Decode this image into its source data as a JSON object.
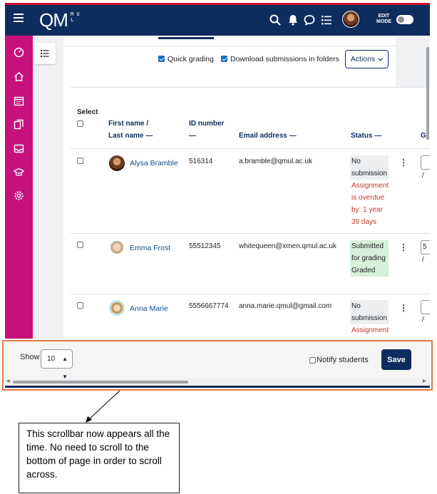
{
  "header": {
    "logo": "QM",
    "logo_sub_1": "M U",
    "logo_sub_2": "L",
    "edit_mode_line1": "EDIT",
    "edit_mode_line2": "MODE"
  },
  "toolbar": {
    "quick_grading": "Quick grading",
    "download_in_folders": "Download submissions in folders",
    "actions": "Actions"
  },
  "table": {
    "select_label": "Select",
    "col_first_name": "First name /",
    "col_last_name": "Last name",
    "col_id": "ID number",
    "col_email": "Email address",
    "col_status": "Status",
    "col_grade_partial": "G",
    "sort_marker": "—",
    "rows": [
      {
        "name": "Alysa Bramble",
        "id": "516314",
        "email": "a.bramble@qmul.ac.uk",
        "status_l1": "No",
        "status_l2": "submission",
        "overdue_l1": "Assignment",
        "overdue_l2": "is overdue",
        "overdue_l3": "by: 1 year",
        "overdue_l4": "39 days",
        "grade": "",
        "slash": "/"
      },
      {
        "name": "Emma Frost",
        "id": "55512345",
        "email": "whitequeen@xmen.qmul.ac.uk",
        "status_l1": "Submitted",
        "status_l2": "for grading",
        "status_l3": "Graded",
        "grade": "5",
        "slash": "/"
      },
      {
        "name": "Anna Marie",
        "id": "5556667774",
        "email": "anna.marie.qmul@gmail.com",
        "status_l1": "No",
        "status_l2": "submission",
        "overdue_l1": "Assignment",
        "grade": "",
        "slash": "/"
      }
    ]
  },
  "footer": {
    "show_label": "Show",
    "show_value": "10",
    "notify_students": "Notify students",
    "save": "Save"
  },
  "annotation": {
    "callout_text": "This scrollbar now appears all the time. No need to scroll to the bottom of page in order to scroll across."
  },
  "colors": {
    "topbar": "#0f2c5e",
    "leftbar": "#c7117c",
    "highlight": "#e07a3c",
    "overdue": "#c0392b",
    "graded_bg": "#d7f0da"
  }
}
